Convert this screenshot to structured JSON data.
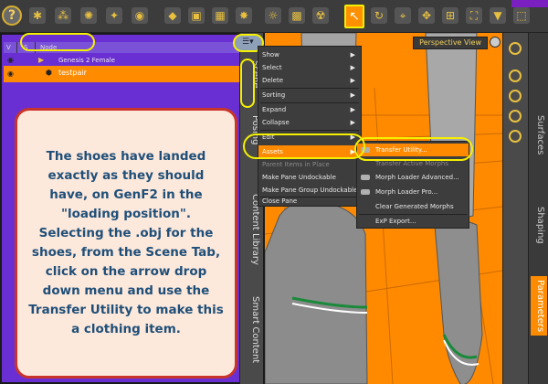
{
  "toolbar": {
    "help_label": "?",
    "select_tool_label": "↖",
    "icons": [
      "figure-icon",
      "joint-icon",
      "spotlight-icon",
      "light-icon",
      "camera-icon",
      "primitive-icon",
      "cube-icon",
      "render-settings-icon",
      "spotlight-alt-icon",
      "sun-icon",
      "shading-icon",
      "node-select-icon",
      "rotate-tool-icon",
      "translate-tool-icon",
      "scale-tool-icon",
      "camera-tool-icon",
      "morph-tool-icon",
      "spotrender-icon"
    ]
  },
  "scene": {
    "col_v": "V",
    "col_s": "S",
    "col_node": "Node",
    "rows": [
      {
        "label": "Genesis 2 Female",
        "selected": false
      },
      {
        "label": "testpair",
        "selected": true
      }
    ]
  },
  "menu": {
    "items": [
      {
        "label": "Show",
        "submenu": true
      },
      {
        "label": "Select",
        "submenu": true
      },
      {
        "label": "Delete",
        "submenu": true
      },
      {
        "label": "Sorting",
        "submenu": true
      },
      {
        "label": "Expand",
        "submenu": true
      },
      {
        "label": "Collapse",
        "submenu": true
      },
      {
        "label": "Edit",
        "submenu": true
      },
      {
        "label": "Assets",
        "submenu": true,
        "highlighted": true
      },
      {
        "label": "Parent Items in Place",
        "dim": true
      },
      {
        "label": "Make Pane Undockable"
      },
      {
        "label": "Make Pane Group Undockable"
      },
      {
        "label": "Close Pane"
      }
    ]
  },
  "submenu": {
    "items": [
      {
        "label": "Transfer Utility...",
        "highlighted": true
      },
      {
        "label": "Transfer Active Morphs",
        "dim": true
      },
      {
        "label": "Morph Loader Advanced..."
      },
      {
        "label": "Morph Loader Pro..."
      },
      {
        "label": "Clear Generated Morphs"
      },
      {
        "label": "ExP Export..."
      }
    ]
  },
  "left_tabs": [
    "Scene",
    "Posing",
    "Content Library",
    "Smart Content"
  ],
  "viewport": {
    "camera_label": "Perspective View"
  },
  "right_tabs": [
    "Surfaces",
    "Shaping",
    "Parameters"
  ],
  "annotation": {
    "text": "The shoes have landed exactly as they should have, on GenF2 in the \"loading position\". Selecting the .obj for the shoes, from the Scene Tab, click on the arrow drop down menu and use the Transfer Utility to make this a clothing item."
  },
  "colors": {
    "accent_orange": "#ff8a00",
    "scene_purple": "#6a2fd3",
    "highlight_yellow": "#f5f000",
    "note_text": "#1f4f78",
    "note_border": "#c8342a"
  }
}
